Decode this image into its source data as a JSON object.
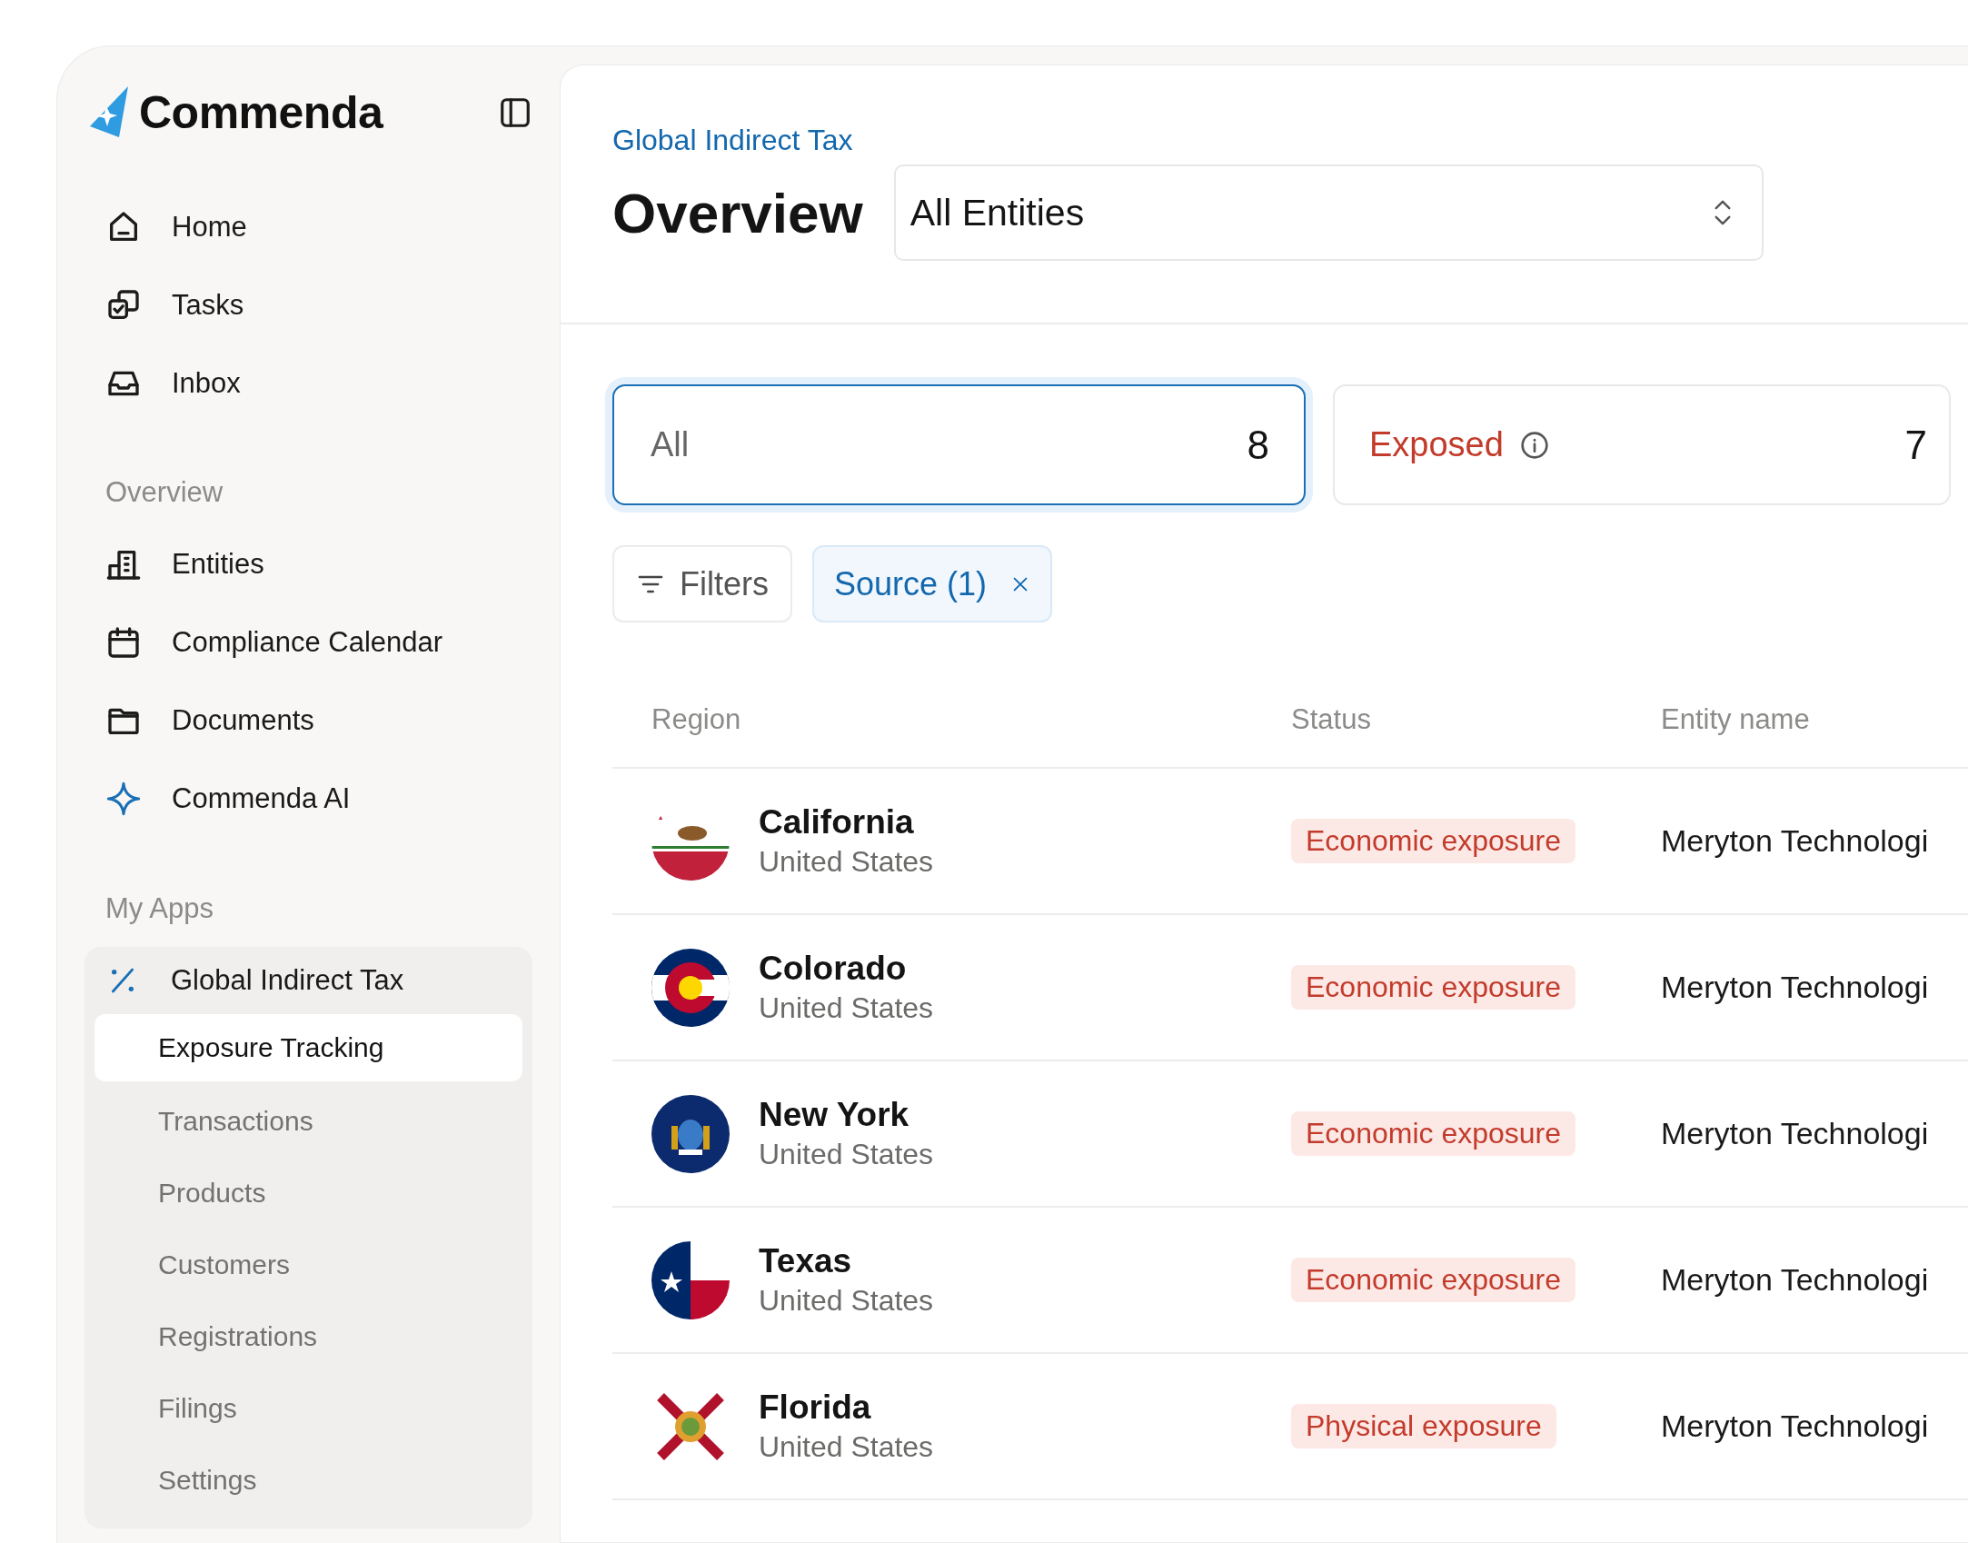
{
  "brand": {
    "name": "Commenda"
  },
  "nav": [
    {
      "label": "Home"
    },
    {
      "label": "Tasks"
    },
    {
      "label": "Inbox"
    }
  ],
  "overview_section": {
    "title": "Overview",
    "items": [
      {
        "label": "Entities"
      },
      {
        "label": "Compliance Calendar"
      },
      {
        "label": "Documents"
      },
      {
        "label": "Commenda AI"
      }
    ]
  },
  "apps_section": {
    "title": "My Apps",
    "group": {
      "label": "Global Indirect Tax",
      "expanded": true,
      "children": [
        {
          "label": "Exposure Tracking",
          "selected": true
        },
        {
          "label": "Transactions",
          "selected": false
        },
        {
          "label": "Products",
          "selected": false
        },
        {
          "label": "Customers",
          "selected": false
        },
        {
          "label": "Registrations",
          "selected": false
        },
        {
          "label": "Filings",
          "selected": false
        },
        {
          "label": "Settings",
          "selected": false
        }
      ]
    }
  },
  "header": {
    "breadcrumb": "Global Indirect Tax",
    "title": "Overview",
    "entity_select": {
      "value": "All Entities"
    }
  },
  "summary_cards": [
    {
      "label": "All",
      "count": "8",
      "selected": true,
      "kind": "plain"
    },
    {
      "label": "Exposed",
      "count": "7",
      "selected": false,
      "kind": "alert"
    }
  ],
  "filters": {
    "button": "Filters",
    "chips": [
      {
        "label": "Source (1)"
      }
    ]
  },
  "table": {
    "columns": [
      "Region",
      "Status",
      "Entity name"
    ],
    "rows": [
      {
        "region": "California",
        "country": "United States",
        "status": "Economic exposure",
        "entity": "Meryton Technologi"
      },
      {
        "region": "Colorado",
        "country": "United States",
        "status": "Economic exposure",
        "entity": "Meryton Technologi"
      },
      {
        "region": "New York",
        "country": "United States",
        "status": "Economic exposure",
        "entity": "Meryton Technologi"
      },
      {
        "region": "Texas",
        "country": "United States",
        "status": "Economic exposure",
        "entity": "Meryton Technologi"
      },
      {
        "region": "Florida",
        "country": "United States",
        "status": "Physical exposure",
        "entity": "Meryton Technologi"
      }
    ]
  }
}
